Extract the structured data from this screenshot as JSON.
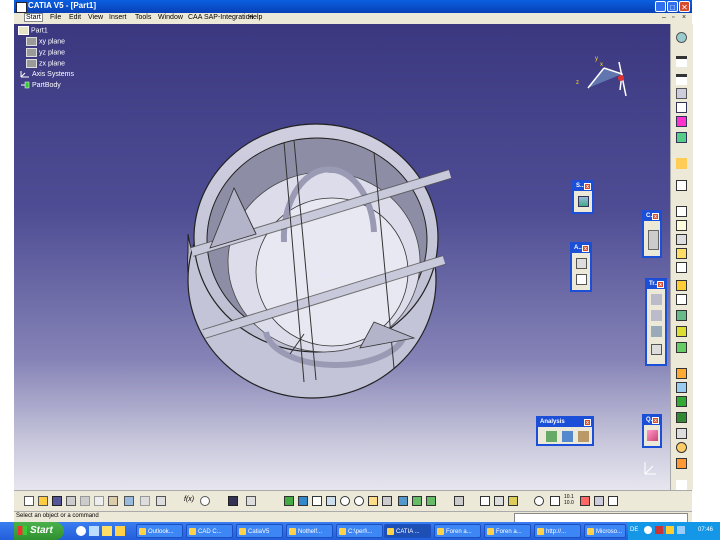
{
  "window": {
    "title": "CATIA V5 - [Part1]"
  },
  "menu": {
    "items": [
      "Start",
      "File",
      "Edit",
      "View",
      "Insert",
      "Tools",
      "Window",
      "CAA SAP-Integration",
      "Help"
    ]
  },
  "tree": {
    "root": "Part1",
    "nodes": [
      "xy plane",
      "yz plane",
      "zx plane",
      "Axis Systems",
      "PartBody"
    ]
  },
  "compass": {
    "labels": [
      "x",
      "y",
      "z"
    ]
  },
  "palettes": {
    "s": {
      "title": "S..."
    },
    "a": {
      "title": "A..."
    },
    "c": {
      "title": "C..."
    },
    "tr": {
      "title": "Tr..."
    },
    "analysis": {
      "title": "Analysis"
    },
    "q": {
      "title": "Q..."
    }
  },
  "bottom_toolbar": {
    "f0_label": "f(x)",
    "scale_label": "10.1\n10.0"
  },
  "status": {
    "text": "Select an object or a command"
  },
  "taskbar": {
    "start": "Start",
    "tasks": [
      "Outlook...",
      "CAD C...",
      "CatiaV5",
      "Nothelf...",
      "C:\\perl\\...",
      "CATIA ...",
      "Foren a...",
      "Foren a...",
      "http://...",
      "Microso..."
    ],
    "active_task": "CATIA ...",
    "lang": "DE",
    "clock": "07:46"
  },
  "colors": {
    "accent": "#1b4fd8",
    "viewport_top": "#3b3880",
    "viewport_bottom": "#e7e6ef",
    "part": "#d8d8e8"
  }
}
